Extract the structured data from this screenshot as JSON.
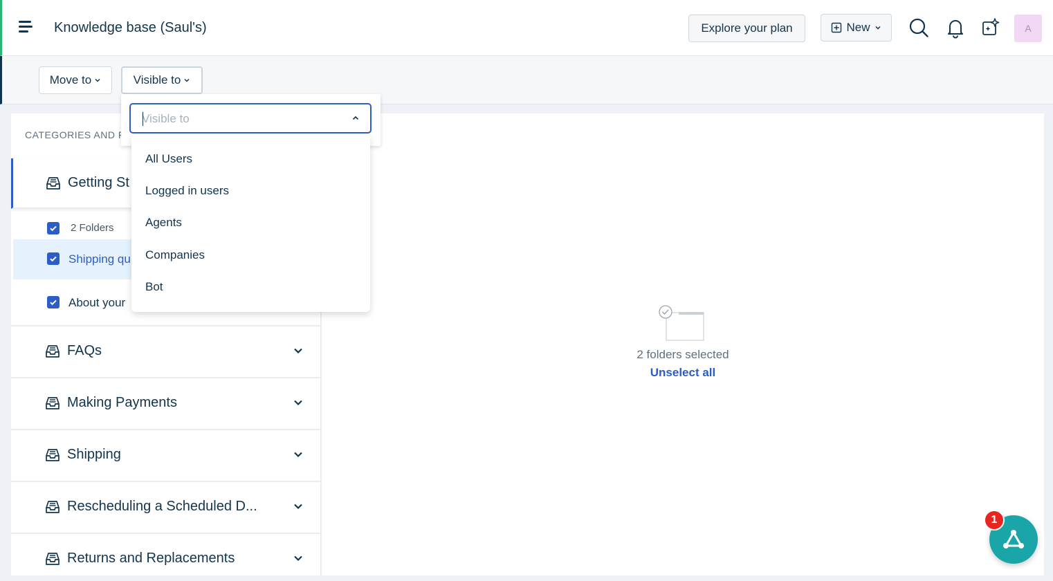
{
  "header": {
    "title": "Knowledge base (Saul's)",
    "explore_label": "Explore your plan",
    "new_label": "New",
    "avatar_initial": "A"
  },
  "toolbar": {
    "move_label": "Move to",
    "visible_label": "Visible to"
  },
  "left_panel": {
    "heading": "CATEGORIES AND F",
    "categories": [
      {
        "label": "Getting St",
        "active": true
      },
      {
        "label": "FAQs"
      },
      {
        "label": "Making Payments"
      },
      {
        "label": "Shipping"
      },
      {
        "label": "Rescheduling a Scheduled D..."
      },
      {
        "label": "Returns and Replacements"
      }
    ],
    "folders_count": "2 Folders",
    "folders": [
      {
        "label": "Shipping qu",
        "checked": true,
        "highlighted": true
      },
      {
        "label": "About your",
        "checked": true
      }
    ]
  },
  "dropdown": {
    "placeholder": "Visible to",
    "options": [
      "All Users",
      "Logged in users",
      "Agents",
      "Companies",
      "Bot"
    ]
  },
  "main": {
    "selected_text": "2 folders selected",
    "unselect_label": "Unselect all"
  },
  "widget": {
    "badge": "1"
  },
  "colors": {
    "accent": "#2c5cc5",
    "brand_green": "#2bb673",
    "widget_teal": "#1aa6a8",
    "badge_red": "#e6261f"
  }
}
